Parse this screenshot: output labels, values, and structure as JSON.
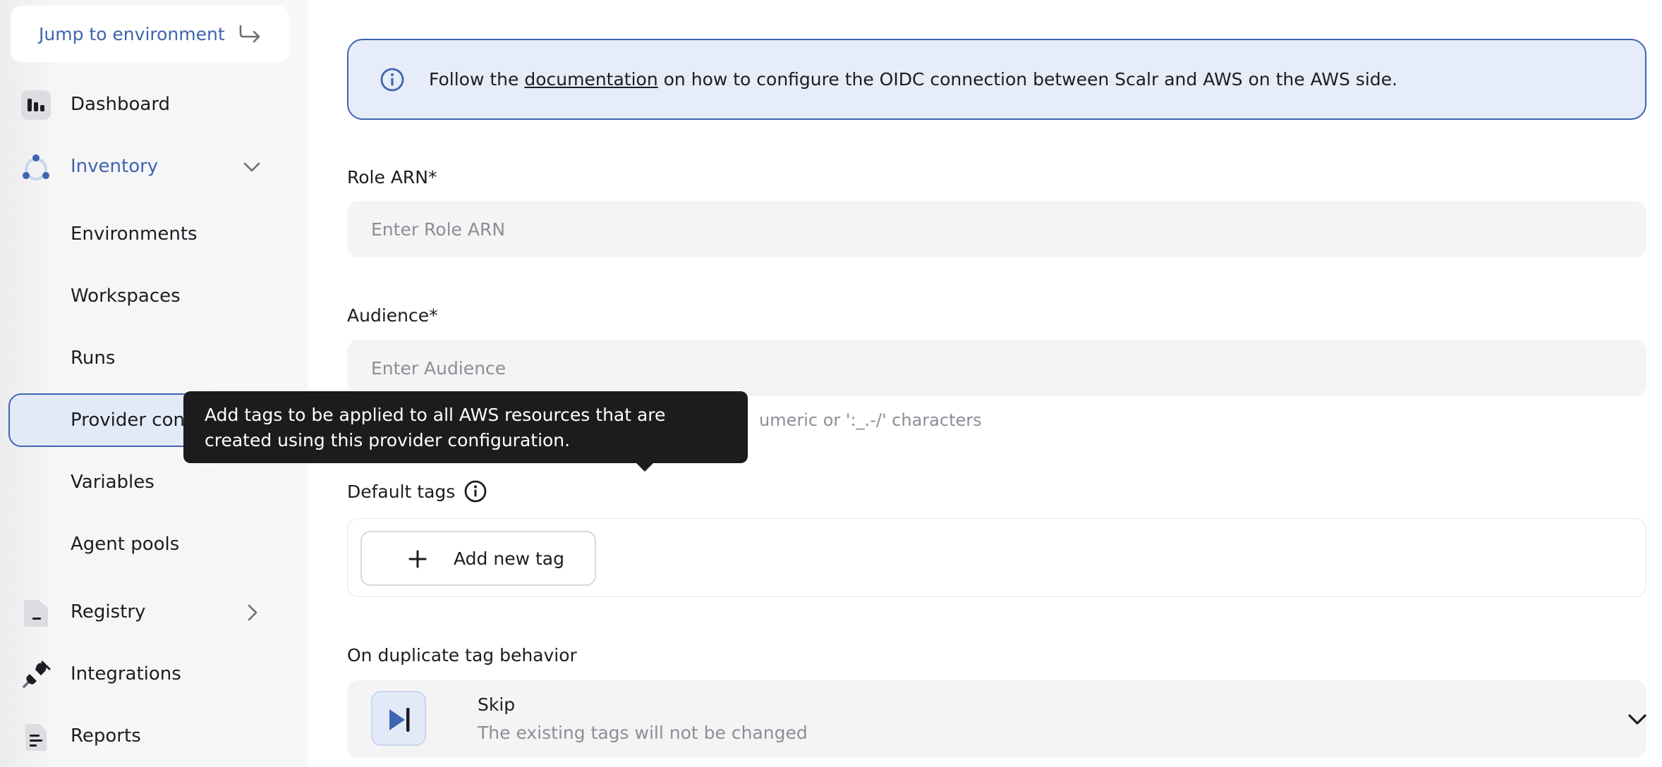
{
  "sidebar": {
    "jump": {
      "label": "Jump to environment",
      "icon": "corner-down-right-icon"
    },
    "items": [
      {
        "label": "Dashboard",
        "icon": "dashboard-icon"
      },
      {
        "label": "Inventory",
        "icon": "inventory-icon",
        "expanded": true
      },
      {
        "label": "Environments"
      },
      {
        "label": "Workspaces"
      },
      {
        "label": "Runs"
      },
      {
        "label": "Provider configurations",
        "active": true
      },
      {
        "label": "Variables"
      },
      {
        "label": "Agent pools"
      },
      {
        "label": "Registry",
        "icon": "registry-icon"
      },
      {
        "label": "Integrations",
        "icon": "plug-icon"
      },
      {
        "label": "Reports",
        "icon": "reports-icon"
      }
    ]
  },
  "banner": {
    "text_before": "Follow the ",
    "link": "documentation",
    "text_after": " on how to configure the OIDC connection between Scalr and AWS on the AWS side."
  },
  "form": {
    "role_arn": {
      "label": "Role ARN*",
      "placeholder": "Enter Role ARN"
    },
    "audience": {
      "label": "Audience*",
      "placeholder": "Enter Audience"
    },
    "hint": "Add tags to be applied to all AWS resources that are created using this provider configuration. Alphanumeric or ':_.-/' characters",
    "hint_visible": "umeric or ':_.-/' characters",
    "default_tags": {
      "label": "Default tags",
      "add_button": "Add new tag"
    },
    "duplicate": {
      "label": "On duplicate tag behavior",
      "selected_title": "Skip",
      "selected_desc": "The existing tags will not be changed"
    }
  },
  "tooltip": {
    "text": "Add tags to be applied to all AWS resources that are created using this provider configuration."
  },
  "colors": {
    "accent": "#3f64b0",
    "banner_bg": "#e6edf9",
    "tooltip_bg": "#1c1c1e"
  }
}
